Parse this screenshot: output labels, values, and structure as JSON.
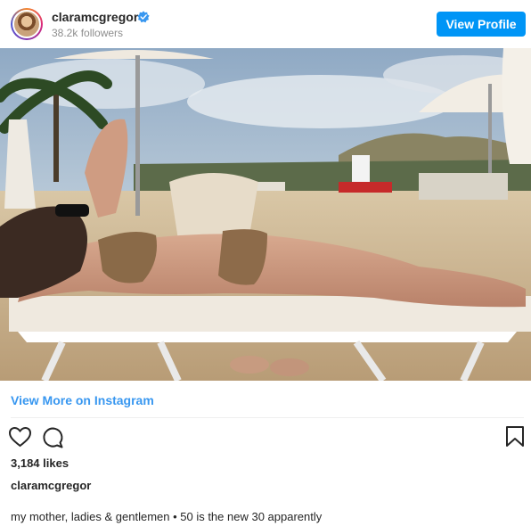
{
  "header": {
    "username": "claramcgregor",
    "followers": "38.2k followers",
    "view_profile_label": "View Profile"
  },
  "links": {
    "view_more": "View More on Instagram"
  },
  "engagement": {
    "likes": "3,184 likes"
  },
  "post": {
    "caption_username": "claramcgregor",
    "caption": "my mother, ladies & gentlemen • 50 is the new 30 apparently"
  },
  "icons": [
    "heart-icon",
    "comment-icon",
    "bookmark-icon",
    "verified-badge-icon"
  ],
  "colors": {
    "accent": "#0095f6",
    "link": "#3897f0",
    "text": "#262626",
    "muted": "#8e8e8e"
  }
}
